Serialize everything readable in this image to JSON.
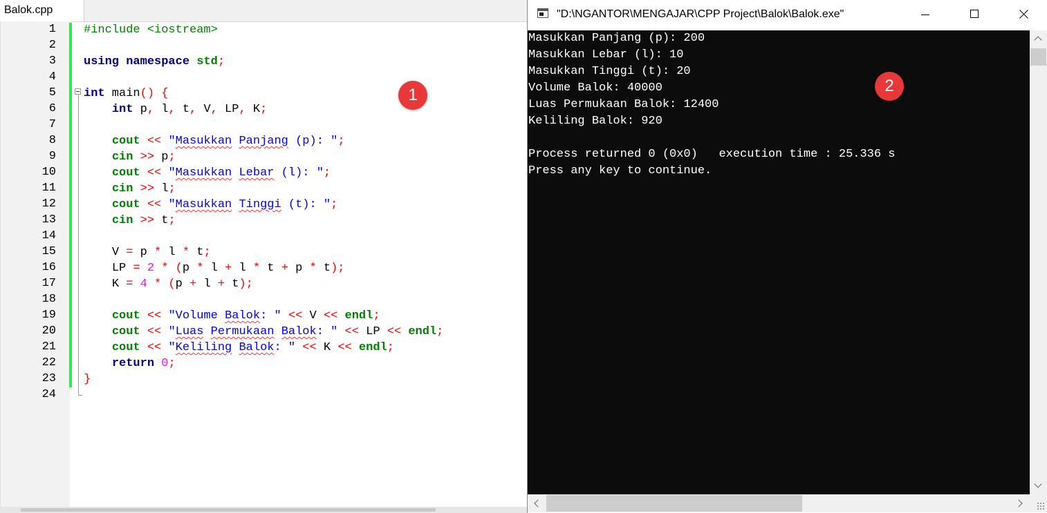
{
  "editor": {
    "tab_label": "Balok.cpp",
    "line_numbers": [
      "1",
      "2",
      "3",
      "4",
      "5",
      "6",
      "7",
      "8",
      "9",
      "10",
      "11",
      "12",
      "13",
      "14",
      "15",
      "16",
      "17",
      "18",
      "19",
      "20",
      "21",
      "22",
      "23",
      "24"
    ]
  },
  "code": {
    "l1_pp": "#include <iostream>",
    "l3_kw1": "using",
    "l3_kw2": "namespace",
    "l3_fn": "std",
    "l3_op": ";",
    "l5_kw": "int",
    "l5_text": " main",
    "l5_op": "() {",
    "l6_kw": "int",
    "l6_text1": " p",
    "l6_c1": ",",
    "l6_text2": " l",
    "l6_c2": ",",
    "l6_text3": " t",
    "l6_c3": ",",
    "l6_text4": " V",
    "l6_c4": ",",
    "l6_text5": " LP",
    "l6_c5": ",",
    "l6_text6": " K",
    "l6_semi": ";",
    "cout": "cout",
    "cin": "cin",
    "shl": "<<",
    "shr": ">>",
    "semi": ";",
    "endl": "endl",
    "q": "\"",
    "l8_w1": "Masukkan",
    "l8_w2": "Panjang",
    "l8_rest": " (p): \"",
    "l9_var": " p",
    "l10_w1": "Masukkan",
    "l10_w2": "Lebar",
    "l10_rest": " (l): \"",
    "l11_var": " l",
    "l12_w1": "Masukkan",
    "l12_w2": "Tinggi",
    "l12_rest": " (t): \"",
    "l13_var": " t",
    "l15_v": "V ",
    "l15_eq": "=",
    "l15_p": " p ",
    "l15_m1": "*",
    "l15_l": " l ",
    "l15_m2": "*",
    "l15_t": " t",
    "l16_lp": "LP ",
    "l16_eq": "=",
    "l16_2": " 2 ",
    "l16_m": "*",
    "l16_open": " (",
    "l16_a": "p ",
    "l16_m2": "*",
    "l16_b": " l ",
    "l16_p1": "+",
    "l16_c": " l ",
    "l16_m3": "*",
    "l16_d": " t ",
    "l16_p2": "+",
    "l16_e": " p ",
    "l16_m4": "*",
    "l16_f": " t",
    "l16_close": ");",
    "l17_k": "K ",
    "l17_eq": "=",
    "l17_4": " 4 ",
    "l17_m": "*",
    "l17_open": " (",
    "l17_a": "p ",
    "l17_p1": "+",
    "l17_b": " l ",
    "l17_p2": "+",
    "l17_c": " t",
    "l17_close": ");",
    "l19_s1": "Volume ",
    "l19_w": "Balok",
    "l19_s2": ": \"",
    "l19_var": " V ",
    "l20_w1": "Luas",
    "l20_w2": "Permukaan",
    "l20_w3": "Balok",
    "l20_s2": ": \"",
    "l20_var": " LP ",
    "l21_w1": "Keliling",
    "l21_w2": "Balok",
    "l21_s2": ": \"",
    "l21_var": " K ",
    "l22_kw": "return",
    "l22_num": " 0",
    "l22_semi": ";",
    "l23_brace": "}"
  },
  "console": {
    "title": "\"D:\\NGANTOR\\MENGAJAR\\CPP Project\\Balok\\Balok.exe\"",
    "lines": [
      "Masukkan Panjang (p): 200",
      "Masukkan Lebar (l): 10",
      "Masukkan Tinggi (t): 20",
      "Volume Balok: 40000",
      "Luas Permukaan Balok: 12400",
      "Keliling Balok: 920",
      "",
      "Process returned 0 (0x0)   execution time : 25.336 s",
      "Press any key to continue."
    ]
  },
  "badges": {
    "one": "1",
    "two": "2",
    "color": "#e8393a"
  },
  "colors": {
    "keyword": "#000080",
    "builtin": "#008000",
    "operator": "#ff0000",
    "string": "#0000ff",
    "number": "#ff00ff",
    "change_bar": "#2ee84e",
    "terminal_bg": "#0c0c0c"
  }
}
